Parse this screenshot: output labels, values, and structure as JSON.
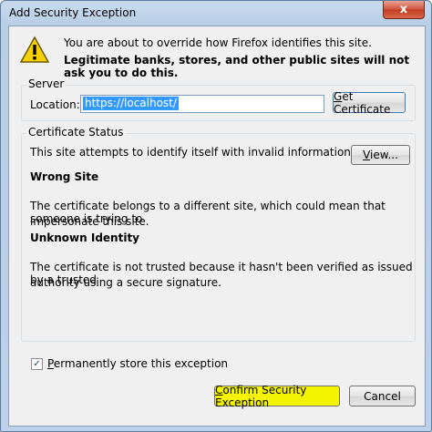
{
  "window": {
    "title": "Add Security Exception",
    "close_glyph": "x"
  },
  "header": {
    "icon": "warning-icon",
    "line1": "You are about to override how Firefox identifies this site.",
    "line2": "Legitimate banks, stores, and other public sites will not ask you to do this."
  },
  "server": {
    "group_label": "Server",
    "location_label": "Location:",
    "location_value": "https://localhost/",
    "get_cert_first": "G",
    "get_cert_rest": "et Certificate"
  },
  "certificate_status": {
    "group_label": "Certificate Status",
    "intro": "This site attempts to identify itself with invalid information.",
    "view_first": "V",
    "view_rest": "iew...",
    "wrong_site_heading": "Wrong Site",
    "wrong_site_line1": "The certificate belongs to a different site, which could mean that someone is trying to",
    "wrong_site_line2": "impersonate this site.",
    "unknown_identity_heading": "Unknown Identity",
    "unknown_identity_line1": "The certificate is not trusted because it hasn't been verified as issued by a trusted",
    "unknown_identity_line2": "authority using a secure signature."
  },
  "permanent": {
    "checked": true,
    "label_first": "P",
    "label_rest": "ermanently store this exception"
  },
  "buttons": {
    "confirm_first": "C",
    "confirm_rest": "onfirm Security Exception",
    "cancel": "Cancel"
  },
  "colors": {
    "highlight": "#f4f400",
    "selection": "#3399ff"
  }
}
